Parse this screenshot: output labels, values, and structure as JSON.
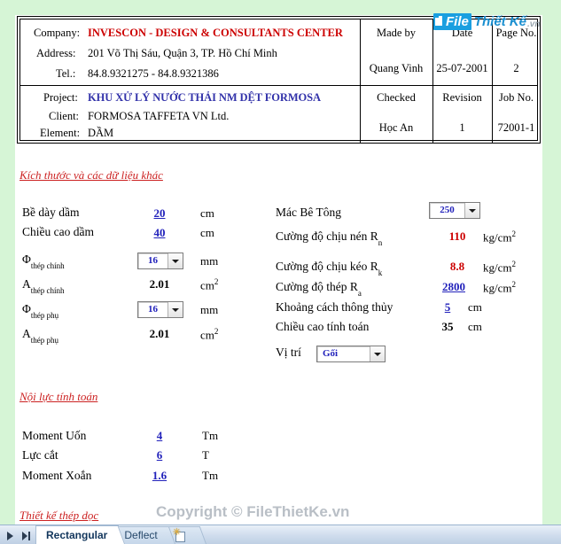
{
  "colors": {
    "page_background": "#d6f5d6",
    "sheet_background": "#ffffff",
    "input_blue": "#2222bb",
    "output_red": "#cc0000",
    "heading_red": "#cc2222",
    "company_red": "#cc0000",
    "project_blue": "#3333aa",
    "watermark_gray": "#b9bfc6",
    "logo_blue": "#1a9fe0"
  },
  "titleblock": {
    "row1": {
      "company_label": "Company:",
      "company_value": "INVESCON - DESIGN & CONSULTANTS CENTER",
      "address_label": "Address:",
      "address_value": "201 Võ Thị Sáu, Quận 3, TP. Hồ Chí Minh",
      "tel_label": "Tel.:",
      "tel_value": "84.8.9321275 - 84.8.9321386",
      "made_by_header": "Made by",
      "made_by_value": "Quang Vinh",
      "date_header": "Date",
      "date_value": "25-07-2001",
      "page_header": "Page No.",
      "page_value": "2"
    },
    "row2": {
      "project_label": "Project:",
      "project_value": "KHU XỬ LÝ NƯỚC THẢI NM DỆT FORMOSA",
      "client_label": "Client:",
      "client_value": "FORMOSA TAFFETA VN Ltd.",
      "element_label": "Element:",
      "element_value": "DẦM",
      "checked_header": "Checked",
      "checked_value": "Học An",
      "revision_header": "Revision",
      "revision_value": "1",
      "job_header": "Job No.",
      "job_value": "72001-1"
    }
  },
  "logo": {
    "file_text": "File",
    "thietke_text": "Thiết Kế",
    "vn_text": ".vn",
    "icon": "pages-icon"
  },
  "section_dimensions": {
    "heading": "Kích thước và các dữ liệu khác",
    "rows_left": [
      {
        "label": "Bề dày dầm",
        "label_sub": "",
        "value": "20",
        "kind": "input",
        "unit": "cm",
        "unit_sup": ""
      },
      {
        "label": "Chiều cao dầm",
        "label_sub": "",
        "value": "40",
        "kind": "input",
        "unit": "cm",
        "unit_sup": ""
      },
      {
        "label": "Φ",
        "label_sub": "thép chính",
        "value": "16",
        "kind": "combo",
        "unit": "mm",
        "unit_sup": ""
      },
      {
        "label": "A",
        "label_sub": "thép chính",
        "value": "2.01",
        "kind": "output",
        "unit": "cm",
        "unit_sup": "2"
      },
      {
        "label": "Φ",
        "label_sub": "thép phụ",
        "value": "16",
        "kind": "combo",
        "unit": "mm",
        "unit_sup": ""
      },
      {
        "label": "A",
        "label_sub": "thép phụ",
        "value": "2.01",
        "kind": "output",
        "unit": "cm",
        "unit_sup": "2"
      }
    ],
    "rows_right": [
      {
        "label": "Mác Bê Tông",
        "label_sub": "",
        "value": "250",
        "kind": "combo",
        "unit": "",
        "unit_sup": ""
      },
      {
        "label": "Cường độ chịu nén R",
        "label_sub": "n",
        "value": "110",
        "kind": "output-red",
        "unit": "kg/cm",
        "unit_sup": "2"
      },
      {
        "label": "Cường độ chịu kéo R",
        "label_sub": "k",
        "value": "8.8",
        "kind": "output-red",
        "unit": "kg/cm",
        "unit_sup": "2"
      },
      {
        "label": "Cường độ thép R",
        "label_sub": "a",
        "value": "2800",
        "kind": "input",
        "unit": "kg/cm",
        "unit_sup": "2"
      },
      {
        "label": "Khoảng cách thông thủy",
        "label_sub": "",
        "value": "5",
        "kind": "input",
        "unit": "cm",
        "unit_sup": ""
      },
      {
        "label": "Chiều cao tính toán",
        "label_sub": "",
        "value": "35",
        "kind": "output",
        "unit": "cm",
        "unit_sup": ""
      }
    ],
    "position_label": "Vị trí",
    "position_value": "Gối"
  },
  "section_forces": {
    "heading": "Nội lực tính toán",
    "rows": [
      {
        "label": "Moment Uốn",
        "value": "4",
        "unit": "Tm"
      },
      {
        "label": "Lực cắt",
        "value": "6",
        "unit": "T"
      },
      {
        "label": "Moment Xoắn",
        "value": "1.6",
        "unit": "Tm"
      }
    ]
  },
  "section_rebar": {
    "heading": "Thiết kế thép dọc"
  },
  "watermark": {
    "copyright": "Copyright © FileThietKe.vn"
  },
  "tabbar": {
    "nav_next": "next-sheet",
    "nav_last": "last-sheet",
    "tabs": [
      {
        "label": "Rectangular",
        "active": true
      },
      {
        "label": "Deflect",
        "active": false
      }
    ],
    "new_sheet_icon": "new-sheet-icon"
  }
}
